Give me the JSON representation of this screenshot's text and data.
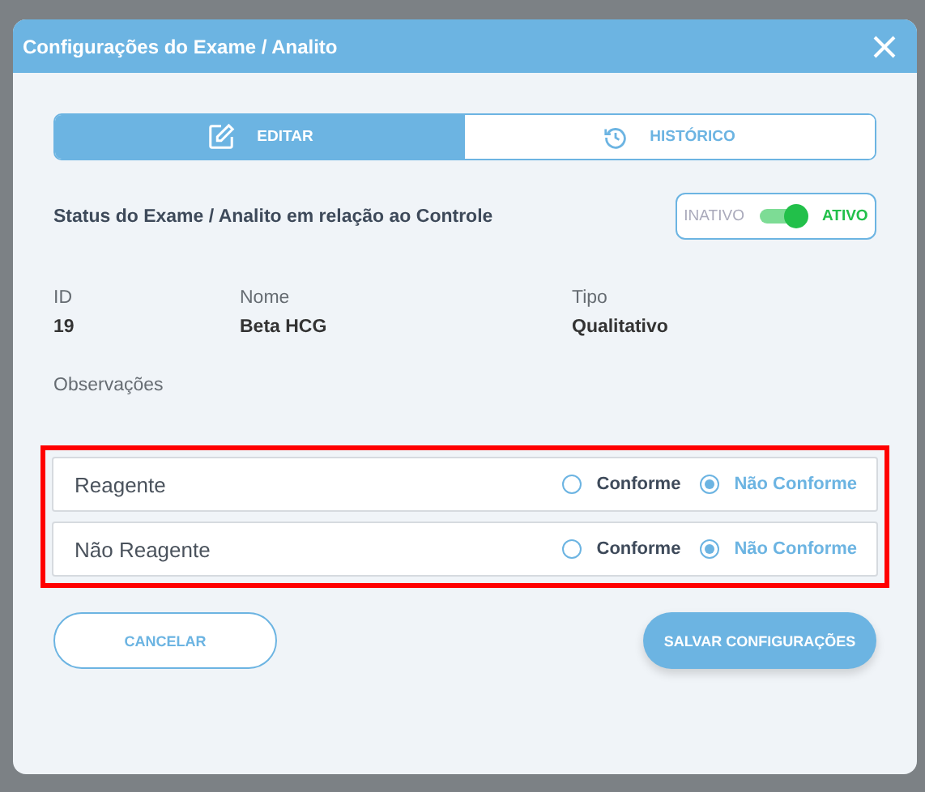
{
  "modal": {
    "title": "Configurações do Exame / Analito"
  },
  "tabs": [
    {
      "label": "EDITAR",
      "selected": true
    },
    {
      "label": "HISTÓRICO",
      "selected": false
    }
  ],
  "status": {
    "label": "Status do Exame / Analito em relação ao Controle",
    "off_label": "INATIVO",
    "on_label": "ATIVO",
    "on": true
  },
  "fields": [
    {
      "label": "ID",
      "value": "19"
    },
    {
      "label": "Nome",
      "value": "Beta HCG"
    },
    {
      "label": "Tipo",
      "value": "Qualitativo"
    }
  ],
  "observations": {
    "label": "Observações"
  },
  "results": [
    {
      "name": "Reagente",
      "options": [
        {
          "label": "Conforme",
          "selected": false
        },
        {
          "label": "Não Conforme",
          "selected": true
        }
      ]
    },
    {
      "name": "Não Reagente",
      "options": [
        {
          "label": "Conforme",
          "selected": false
        },
        {
          "label": "Não Conforme",
          "selected": true
        }
      ]
    }
  ],
  "buttons": [
    {
      "label": "CANCELAR",
      "kind": "outline"
    },
    {
      "label": "SALVAR CONFIGURAÇÕES",
      "kind": "primary"
    }
  ]
}
